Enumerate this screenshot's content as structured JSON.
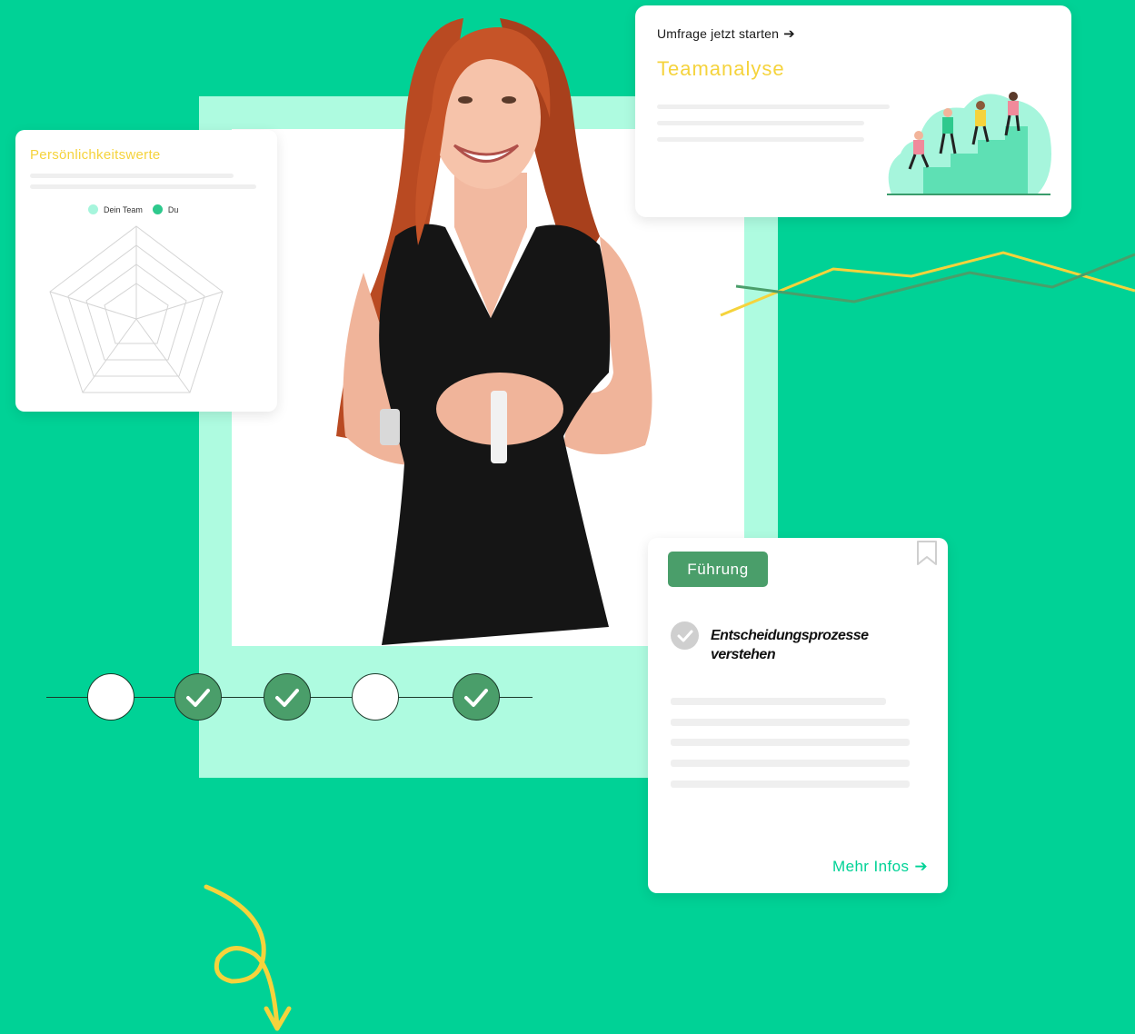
{
  "colors": {
    "background": "#00d296",
    "mint_frame": "#aefbe0",
    "accent_yellow": "#f5d33c",
    "badge_green": "#4a9e6a",
    "legend_team": "#a6f5dc",
    "legend_you": "#2ec98d"
  },
  "radar_card": {
    "title": "Persönlichkeitswerte",
    "legend": [
      {
        "label": "Dein Team",
        "color": "#a6f5dc"
      },
      {
        "label": "Du",
        "color": "#2ec98d"
      }
    ]
  },
  "survey_card": {
    "cta_label": "Umfrage jetzt starten",
    "cta_icon": "arrow-right-icon",
    "title": "Teamanalyse",
    "illustration": "team-climbing-stairs-illustration"
  },
  "lead_card": {
    "badge": "Führung",
    "title": "Entscheidungsprozesse verstehen",
    "more_label": "Mehr Infos",
    "more_icon": "arrow-right-icon",
    "bookmark_icon": "bookmark-icon",
    "check_icon": "check-circle-icon"
  },
  "progress_steps": [
    {
      "state": "open"
    },
    {
      "state": "done"
    },
    {
      "state": "done"
    },
    {
      "state": "open"
    },
    {
      "state": "done"
    }
  ]
}
